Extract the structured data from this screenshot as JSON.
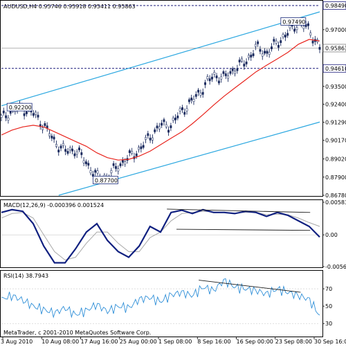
{
  "colors": {
    "price": "#1a2a5e",
    "ma": "#e8231c",
    "channel": "#2aa7e0",
    "macd": "#102080",
    "signal": "#a8a8a8",
    "rsi": "#2f8fd8",
    "divergence": "#1a1a1a",
    "level_line": "#1a1a7a",
    "current_price_box": "#ffffff"
  },
  "header": {
    "main": "AUDUSD,H4  0.95746 0.95918 0.95411 0.95863",
    "macd": "MACD(12,26,9) -0.000396 0.001524",
    "rsi": "RSI(14) 38.7943"
  },
  "copyright": "MetaTrader, c 2001-2010 MetaQuotes Software Corp.",
  "chart_data": [
    {
      "type": "line",
      "panel": "price",
      "y_ticks": [
        "0.98490",
        "0.97000",
        "0.95863",
        "0.94610",
        "0.93500",
        "0.92400",
        "0.91290",
        "0.90170",
        "0.89020",
        "0.87900",
        "0.86780"
      ],
      "ylim": [
        0.8678,
        0.9849
      ],
      "x": [
        0,
        0.033,
        0.067,
        0.1,
        0.133,
        0.167,
        0.2,
        0.233,
        0.267,
        0.3,
        0.333,
        0.367,
        0.4,
        0.433,
        0.467,
        0.5,
        0.533,
        0.567,
        0.6,
        0.633,
        0.667,
        0.7,
        0.733,
        0.767,
        0.8,
        0.833,
        0.867,
        0.9,
        0.933,
        0.967,
        1.0
      ],
      "series": [
        {
          "values": [
            0.915,
            0.92,
            0.9215,
            0.9185,
            0.911,
            0.901,
            0.895,
            0.896,
            0.888,
            0.879,
            0.879,
            0.886,
            0.891,
            0.896,
            0.904,
            0.911,
            0.911,
            0.92,
            0.926,
            0.934,
            0.942,
            0.94,
            0.946,
            0.95,
            0.959,
            0.9555,
            0.962,
            0.968,
            0.9745,
            0.97,
            0.9586
          ]
        },
        {
          "values": [
            0.905,
            0.908,
            0.91,
            0.911,
            0.91,
            0.907,
            0.904,
            0.901,
            0.898,
            0.894,
            0.891,
            0.8895,
            0.89,
            0.892,
            0.895,
            0.899,
            0.903,
            0.907,
            0.912,
            0.9175,
            0.9235,
            0.929,
            0.934,
            0.939,
            0.944,
            0.948,
            0.952,
            0.956,
            0.961,
            0.964,
            0.963
          ]
        }
      ],
      "annotations": [
        {
          "text": "0.92200",
          "x": 0.02,
          "y": 0.922
        },
        {
          "text": "0.87700",
          "x": 0.29,
          "y": 0.877
        },
        {
          "text": "0.97490",
          "x": 0.88,
          "y": 0.9749
        }
      ],
      "levels": [
        {
          "label": "0.98490",
          "y": 0.9849,
          "style": "dashed"
        },
        {
          "label": "0.95863",
          "y": 0.95863,
          "style": "solid"
        },
        {
          "label": "0.94610",
          "y": 0.9461,
          "style": "dashed"
        }
      ],
      "channel": [
        {
          "x0": 0.0,
          "y0": 0.923,
          "x1": 1.0,
          "y1": 0.981
        },
        {
          "x0": 0.18,
          "y0": 0.8678,
          "x1": 1.0,
          "y1": 0.913
        }
      ]
    },
    {
      "type": "line",
      "panel": "macd",
      "y_ticks": [
        "0.005834",
        "0.00",
        "-0.005675"
      ],
      "ylim": [
        -0.005675,
        0.005834
      ],
      "x": [
        0,
        0.033,
        0.067,
        0.1,
        0.133,
        0.167,
        0.2,
        0.233,
        0.267,
        0.3,
        0.333,
        0.367,
        0.4,
        0.433,
        0.467,
        0.5,
        0.533,
        0.567,
        0.6,
        0.633,
        0.667,
        0.7,
        0.733,
        0.767,
        0.8,
        0.833,
        0.867,
        0.9,
        0.933,
        0.967,
        1.0
      ],
      "series": [
        {
          "values": [
            0.004,
            0.0045,
            0.0042,
            0.002,
            -0.002,
            -0.005,
            -0.005,
            -0.0025,
            0.0005,
            0.002,
            -0.001,
            -0.003,
            -0.004,
            -0.002,
            0.0015,
            0.0005,
            0.004,
            0.0044,
            0.0038,
            0.0045,
            0.004,
            0.004,
            0.0038,
            0.0042,
            0.004,
            0.0033,
            0.004,
            0.0035,
            0.0025,
            0.0015,
            -0.0004
          ]
        },
        {
          "values": [
            0.003,
            0.0038,
            0.004,
            0.003,
            0.0,
            -0.003,
            -0.0045,
            -0.004,
            -0.0015,
            0.0005,
            0.0005,
            -0.0015,
            -0.003,
            -0.003,
            -0.0005,
            0.0005,
            0.0025,
            0.0038,
            0.004,
            0.0042,
            0.0041,
            0.004,
            0.0039,
            0.004,
            0.004,
            0.0036,
            0.0037,
            0.0036,
            0.003,
            0.0022,
            0.0015
          ]
        }
      ],
      "divergence_lines": [
        {
          "x0": 0.52,
          "y0": 0.0046,
          "x1": 0.97,
          "y1": 0.004
        },
        {
          "x0": 0.55,
          "y0": 0.001,
          "x1": 0.97,
          "y1": 0.0008
        }
      ]
    },
    {
      "type": "line",
      "panel": "rsi",
      "y_ticks": [
        "70",
        "50",
        "30"
      ],
      "ylim": [
        15,
        90
      ],
      "x": [
        0,
        0.033,
        0.067,
        0.1,
        0.133,
        0.167,
        0.2,
        0.233,
        0.267,
        0.3,
        0.333,
        0.367,
        0.4,
        0.433,
        0.467,
        0.5,
        0.533,
        0.567,
        0.6,
        0.633,
        0.667,
        0.7,
        0.733,
        0.767,
        0.8,
        0.833,
        0.867,
        0.9,
        0.933,
        0.967,
        1.0
      ],
      "series": [
        {
          "values": [
            58,
            62,
            57,
            50,
            46,
            42,
            48,
            40,
            45,
            52,
            44,
            50,
            48,
            58,
            60,
            55,
            63,
            66,
            62,
            72,
            68,
            80,
            72,
            70,
            68,
            64,
            70,
            66,
            62,
            58,
            39
          ]
        }
      ],
      "divergence_lines": [
        {
          "x0": 0.62,
          "y0": 80,
          "x1": 0.94,
          "y1": 66
        }
      ]
    }
  ],
  "x_ticks": [
    "3 Aug 2010",
    "10 Aug 08:00",
    "17 Aug 16:00",
    "25 Aug 00:00",
    "1 Sep 08:00",
    "8 Sep 16:00",
    "16 Sep 00:00",
    "23 Sep 08:00",
    "30 Sep 16:00"
  ]
}
